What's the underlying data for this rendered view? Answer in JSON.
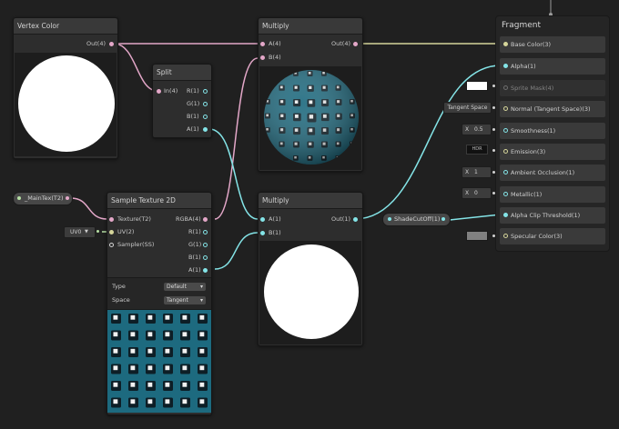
{
  "colors": {
    "pink": "#e3a7c8",
    "teal": "#84e4e7",
    "olive": "#d5d59a",
    "node_bg": "#2d2d2d",
    "canvas": "#202020"
  },
  "vertex_color": {
    "title": "Vertex Color",
    "out": "Out(4)"
  },
  "split": {
    "title": "Split",
    "in": "In(4)",
    "r": "R(1)",
    "g": "G(1)",
    "b": "B(1)",
    "a": "A(1)"
  },
  "multiply_top": {
    "title": "Multiply",
    "a": "A(4)",
    "b": "B(4)",
    "out": "Out(4)"
  },
  "multiply_bottom": {
    "title": "Multiply",
    "a": "A(1)",
    "b": "B(1)",
    "out": "Out(1)"
  },
  "main_tex": {
    "label": "_MainTex(T2)"
  },
  "uv_select": {
    "value": "UV0"
  },
  "sample_texture": {
    "title": "Sample Texture 2D",
    "inputs": [
      "Texture(T2)",
      "UV(2)",
      "Sampler(SS)"
    ],
    "outputs": [
      "RGBA(4)",
      "R(1)",
      "G(1)",
      "B(1)",
      "A(1)"
    ],
    "type_label": "Type",
    "type_value": "Default",
    "space_label": "Space",
    "space_value": "Tangent"
  },
  "shade_cutoff": {
    "label": "ShadeCutOff(1)"
  },
  "fragment": {
    "title": "Fragment",
    "rows": [
      {
        "label": "Base Color(3)"
      },
      {
        "label": "Alpha(1)"
      },
      {
        "label": "Sprite Mask(4)"
      },
      {
        "label": "Normal (Tangent Space)(3)"
      },
      {
        "label": "Smoothness(1)"
      },
      {
        "label": "Emission(3)"
      },
      {
        "label": "Ambient Occlusion(1)"
      },
      {
        "label": "Metallic(1)"
      },
      {
        "label": "Alpha Clip Threshold(1)"
      },
      {
        "label": "Specular Color(3)"
      }
    ],
    "inline": {
      "tangent_space": "Tangent Space",
      "smoothness_axis": "X",
      "smoothness_value": "0.5",
      "emission_hdr": "HDR",
      "ao_axis": "X",
      "ao_value": "1",
      "metallic_axis": "X",
      "metallic_value": "0"
    }
  }
}
